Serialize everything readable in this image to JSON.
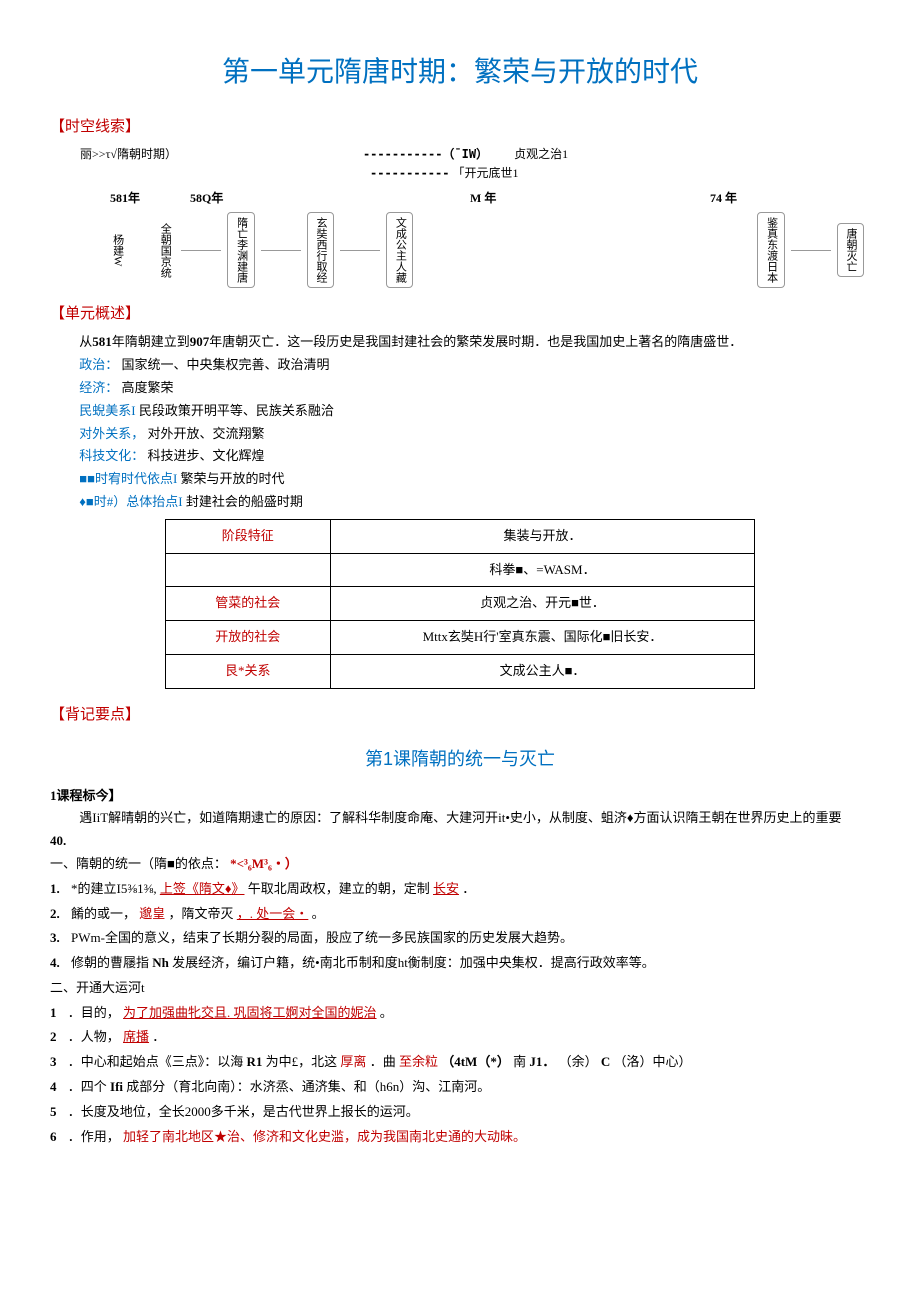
{
  "title": "第一单元隋唐时期：繁荣与开放的时代",
  "sections": {
    "timeline_h": "【时空线索】",
    "overview_h": "【单元概述】",
    "memo_h": "【背记要点】",
    "course_h": "1课程标今】"
  },
  "timeline": {
    "top_line": "丽>>τ√隋朝时期）",
    "arrow1": "-----------（¯IW）",
    "label1": "贞观之治1",
    "arrow2": "-----------",
    "label2": "「开元底世1",
    "y581": "581年",
    "y58Q": "58Q年",
    "yM": "M 年",
    "y74": "74 年",
    "vl1": "杨建W",
    "vl2": "全朝国京统",
    "box1": "隋亡李渊建唐",
    "box2": "玄奘西行取经",
    "box3": "文成公主人藏",
    "box4": "鉴真东渡日本",
    "box5": "唐朝灭亡"
  },
  "overview": {
    "intro": "从581年隋朝建立到907年唐朝灭亡．这一段历史是我国封建社会的繁荣发展时期．也是我国加史上著名的隋唐盛世．",
    "pol_l": "政治：",
    "pol_v": "国家统一、中央集权完善、政治清明",
    "eco_l": "经济：",
    "eco_v": "高度繁荣",
    "eth_l": "民蜺美系I",
    "eth_v": "民段政策开明平等、民族关系融洽",
    "for_l": "对外关系，",
    "for_v": "对外开放、交流翔繁",
    "sci_l": "科技文化：",
    "sci_v": "科技进步、文化辉煌",
    "era_l": "■■时宥时代依点I",
    "era_v": "繁荣与开放的时代",
    "tot_l": "♦■时#）总体抬点I",
    "tot_v": "封建社会的船盛时期"
  },
  "feature_table": {
    "r1c1": "阶段特征",
    "r1c2": "集装与开放．",
    "r2c1": "",
    "r2c2": "科拳■、=WASM．",
    "r3c1": "管菜的社会",
    "r3c2": "贞观之治、开元■世．",
    "r4c1": "开放的社会",
    "r4c2": "Mttx玄奘H行'室真东震、国际化■旧长安．",
    "r5c1": "艮*关系",
    "r5c2": "文成公主人■．"
  },
  "lesson1": {
    "title": "第1课隋朝的统一与灭亡",
    "course": "遇IiT解晴朝的兴亡，如道隋期逮亡的原因：了解科华制度命庵、大建河开it•史小，从制度、蛆济♦方面认识隋王朝在世界历史上的重要",
    "n40": "40.",
    "sec1_h_pre": "一、隋朝的统一（隋■的依点：",
    "sec1_h_red": "*<³₆M³₆・）",
    "p1_pre": "*的建立I5⅜1⅜,",
    "p1_link": "上签《隋文♦》",
    "p1_post": "午取北周政权，建立的朝，定制",
    "p1_link2": "长安",
    "p1_end": "．",
    "p2_pre": "餚的或一，",
    "p2_red": "邈皇",
    "p2_mid": "，隋文帝灭",
    "p2_link": "，. 处一会・",
    "p2_end": "。",
    "p3": "PWm-全国的意义，结束了长期分裂的局面，股应了统一多民族国家的历史发展大趋势。",
    "p4_pre": "修朝的曹屦指",
    "p4_b": "Nh",
    "p4_post": "发展经济，编订户籍，统•南北币制和度ht衡制度：加强中央集权．提高行政效率等。",
    "sec2_h": "二、开通大运河t",
    "q1_pre": "．目的，",
    "q1_red": "为了加强曲牝交且. 巩固将工婀对全国的妮治",
    "q1_end": "。",
    "q2_pre": "．人物，",
    "q2_red": "席播",
    "q2_end": "．",
    "q3_pre": "．中心和起始点《三点》：以海",
    "q3_b1": "R1",
    "q3_mid1": "为中£，北这",
    "q3_red1": "厚离",
    "q3_mid2": "．曲",
    "q3_red2": "至余粒",
    "q3_b2": "（4tM（*）",
    "q3_mid3": "南",
    "q3_b3": "J1．",
    "q3_mid4": "（余）",
    "q3_b4": "C",
    "q3_end": "（洛）中心）",
    "q4_pre": "．四个",
    "q4_b": "Ifi",
    "q4_post": "成部分（育北向南）：水济烝、通济集、和（h6n）沟、江南河。",
    "q5": "．长度及地位，全长2000多千米，是古代世界上报长的运河。",
    "q6_pre": "．作用，",
    "q6_red": "加轻了南北地区★治、修济和文化史滥，成为我国南北史通的大动昧。"
  }
}
